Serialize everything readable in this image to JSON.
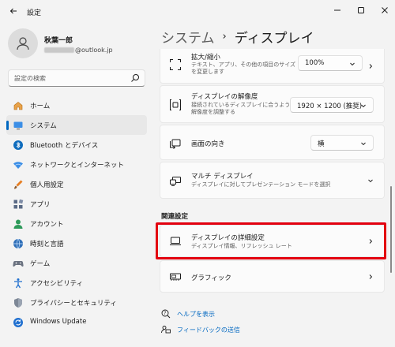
{
  "window": {
    "title": "設定"
  },
  "user": {
    "name": "秋葉一郎",
    "email_suffix": "@outlook.jp"
  },
  "search": {
    "placeholder": "設定の検索"
  },
  "nav": [
    {
      "label": "ホーム",
      "icon": "home-icon"
    },
    {
      "label": "システム",
      "icon": "system-icon",
      "active": true
    },
    {
      "label": "Bluetooth とデバイス",
      "icon": "bluetooth-icon"
    },
    {
      "label": "ネットワークとインターネット",
      "icon": "network-icon"
    },
    {
      "label": "個人用設定",
      "icon": "personalization-icon"
    },
    {
      "label": "アプリ",
      "icon": "apps-icon"
    },
    {
      "label": "アカウント",
      "icon": "account-icon"
    },
    {
      "label": "時刻と言語",
      "icon": "time-language-icon"
    },
    {
      "label": "ゲーム",
      "icon": "gaming-icon"
    },
    {
      "label": "アクセシビリティ",
      "icon": "accessibility-icon"
    },
    {
      "label": "プライバシーとセキュリティ",
      "icon": "privacy-icon"
    },
    {
      "label": "Windows Update",
      "icon": "windows-update-icon"
    }
  ],
  "breadcrumb": {
    "parent": "システム",
    "separator": "›",
    "current": "ディスプレイ"
  },
  "settings": {
    "scale": {
      "title": "拡大/縮小",
      "desc": "テキスト、アプリ、その他の項目のサイズを変更します",
      "value": "100%"
    },
    "resolution": {
      "title": "ディスプレイの解像度",
      "desc": "接続されているディスプレイに合うように解像度を調整する",
      "value": "1920 × 1200 (推奨)"
    },
    "orientation": {
      "title": "画面の向き",
      "value": "横"
    },
    "multi": {
      "title": "マルチ ディスプレイ",
      "desc": "ディスプレイに対してプレゼンテーション モードを選択"
    }
  },
  "related": {
    "label": "関連設定",
    "advanced": {
      "title": "ディスプレイの詳細設定",
      "desc": "ディスプレイ情報、リフレッシュ レート"
    },
    "graphics": {
      "title": "グラフィック"
    }
  },
  "links": {
    "help": "ヘルプを表示",
    "feedback": "フィードバックの送信"
  },
  "colors": {
    "accent": "#0067c0",
    "highlight": "#e3000f"
  }
}
